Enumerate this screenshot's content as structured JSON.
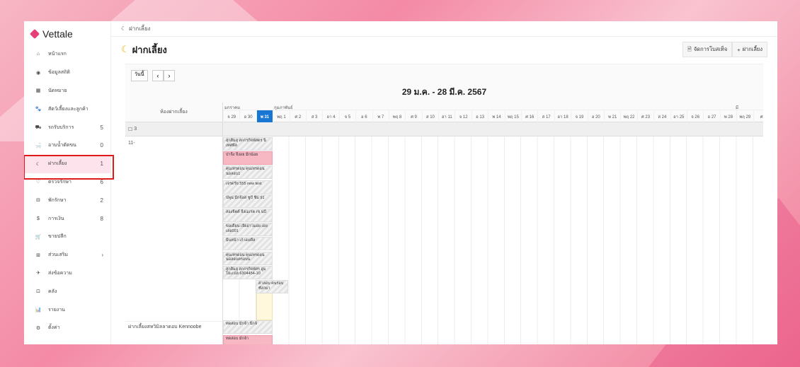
{
  "app": {
    "name": "Vettale"
  },
  "breadcrumb": {
    "text": "ฝากเลี้ยง"
  },
  "page": {
    "title": "ฝากเลี้ยง"
  },
  "actions": {
    "manage_label": "จัดการโบสเท็จ",
    "add_label": "ฝากเลี้ยง"
  },
  "sidebar": {
    "items": [
      {
        "label": "หน้าแรก",
        "count": ""
      },
      {
        "label": "ข้อมูลสถิติ",
        "count": ""
      },
      {
        "label": "นัดหมาย",
        "count": ""
      },
      {
        "label": "สัตว์เลี้ยงและลูกค้า",
        "count": ""
      },
      {
        "label": "รถรับบริการ",
        "count": "5"
      },
      {
        "label": "อาบน้ำตัดขน",
        "count": "0"
      },
      {
        "label": "ฝากเลี้ยง",
        "count": "1"
      },
      {
        "label": "ตรวจรักษา",
        "count": "6"
      },
      {
        "label": "พักรักษา",
        "count": "2"
      },
      {
        "label": "การเงิน",
        "count": "8"
      },
      {
        "label": "ขายปลีก",
        "count": ""
      },
      {
        "label": "ส่วนเสริม",
        "count": ""
      },
      {
        "label": "ส่งข้อความ",
        "count": ""
      },
      {
        "label": "คลัง",
        "count": ""
      },
      {
        "label": "รายงาน",
        "count": ""
      },
      {
        "label": "ตั้งค่า",
        "count": ""
      }
    ]
  },
  "calendar": {
    "today_label": "วันนี้",
    "range": "29 ม.ค. - 28 มี.ค. 2567",
    "resource_header": "ห้องฝากเลี้ยง",
    "group_label": "3",
    "resource1": "11-",
    "resource2": "ฝากเลี้ยงสหวิมิลลาดอบ Kennoobe",
    "months": [
      "มกราคม",
      "กุมภาพันธ์",
      "มี"
    ],
    "days": [
      "จ 29",
      "อ 30",
      "พ 31",
      "พฤ 1",
      "ศ 2",
      "ส 3",
      "อา 4",
      "จ 5",
      "อ 6",
      "พ 7",
      "พฤ 8",
      "ศ 9",
      "ส 10",
      "อา 11",
      "จ 12",
      "อ 13",
      "พ 14",
      "พฤ 15",
      "ศ 16",
      "ส 17",
      "อา 18",
      "จ 19",
      "อ 20",
      "พ 21",
      "พฤ 22",
      "ศ 23",
      "ส 24",
      "อา 25",
      "จ 26",
      "อ 27",
      "พ 28",
      "พฤ 29",
      "ศ"
    ],
    "bookings": [
      "สุกสิมสุ สกกรกิจพัสตร นิเทศพีล",
      "ป่าจิ้ง จิ้งอย มีกน้อย",
      "คุนเทรดอน คุนเทรดอน นอลอบ1",
      "เจรดรัย 555 new test",
      "ปพุน มีกจ้อส ชูบั ชิ่ม 91",
      "สองจิตต์ จิ้งเมเรต เข นบี",
      "ขอเดียน เจียอ่าวมอย เอยเล่อ001",
      "มินหน้า เก้ เดยลีส",
      "คุนเทรดอน คุนเทรดอน นอลอบครอบน",
      "สุกสิมสุ สกกรกิจพัสร ฮูมโยะเปล 6304454-10",
      "สาลอบ คนรอบ ซังกมา",
      "ทดสอบ มักจ้า นีกจ้",
      "ทดสอบ มักจ้า"
    ]
  },
  "colors": {
    "accent": "#e83e78",
    "today": "#1976d2",
    "active_bg": "#fde4ec",
    "highlight_border": "#e11919"
  }
}
